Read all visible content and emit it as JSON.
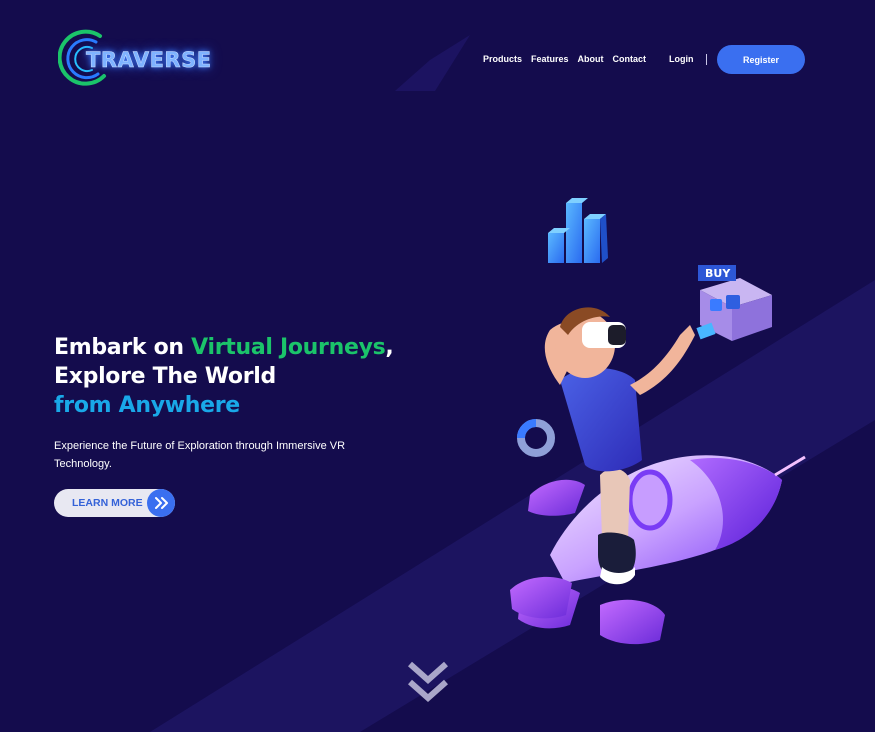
{
  "brand": {
    "name": "TRAVERSE"
  },
  "nav": {
    "items": [
      "Products",
      "Features",
      "About",
      "Contact"
    ],
    "login_label": "Login",
    "register_label": "Register"
  },
  "hero": {
    "title_line1_prefix": "Embark on ",
    "title_line1_highlight": "Virtual Journeys",
    "title_line1_suffix": ",",
    "title_line2": "Explore The World",
    "title_line3": "from Anywhere",
    "subtitle": "Experience the Future of Exploration through Immersive VR Technology.",
    "cta_label": "LEARN MORE"
  },
  "illustration": {
    "buy_sign": "BUY"
  },
  "colors": {
    "background": "#140c4d",
    "accent_blue": "#3a6ff0",
    "highlight_green": "#1bc46a",
    "highlight_cyan": "#19a8e8"
  },
  "icons": {
    "cta_arrow": "double-chevron-right-icon",
    "scroll": "double-chevron-down-icon"
  }
}
